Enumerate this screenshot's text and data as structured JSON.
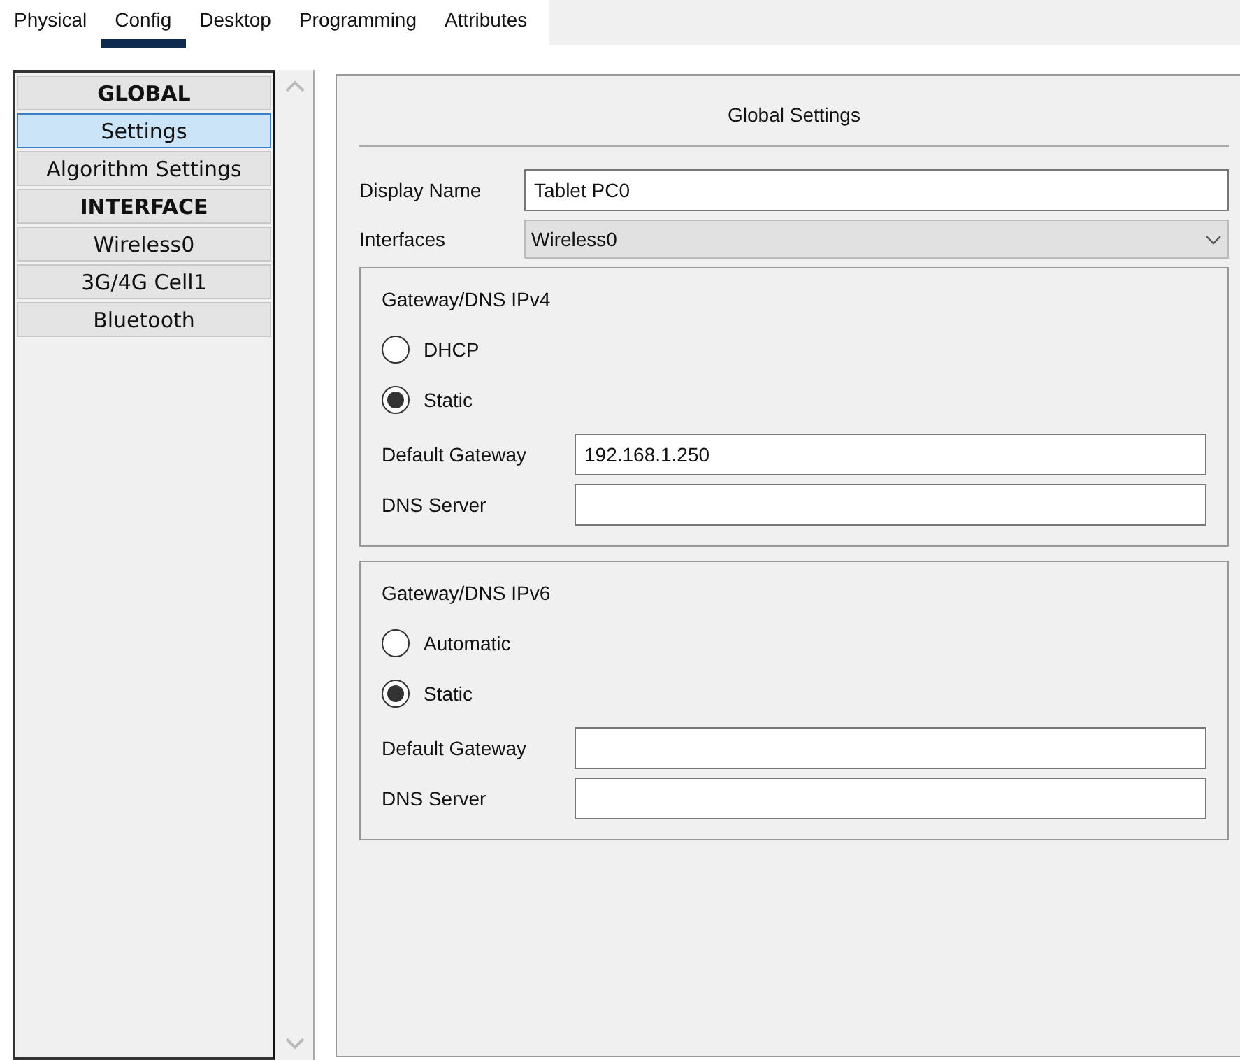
{
  "tabs": [
    {
      "label": "Physical",
      "selected": false
    },
    {
      "label": "Config",
      "selected": true
    },
    {
      "label": "Desktop",
      "selected": false
    },
    {
      "label": "Programming",
      "selected": false
    },
    {
      "label": "Attributes",
      "selected": false
    }
  ],
  "sidebar": {
    "items": [
      {
        "label": "GLOBAL",
        "kind": "header",
        "selected": false
      },
      {
        "label": "Settings",
        "kind": "item",
        "selected": true
      },
      {
        "label": "Algorithm Settings",
        "kind": "item",
        "selected": false
      },
      {
        "label": "INTERFACE",
        "kind": "header",
        "selected": false
      },
      {
        "label": "Wireless0",
        "kind": "item",
        "selected": false
      },
      {
        "label": "3G/4G Cell1",
        "kind": "item",
        "selected": false
      },
      {
        "label": "Bluetooth",
        "kind": "item",
        "selected": false
      }
    ]
  },
  "panel": {
    "title": "Global Settings",
    "display_name": {
      "label": "Display Name",
      "value": "Tablet PC0"
    },
    "interfaces": {
      "label": "Interfaces",
      "value": "Wireless0"
    },
    "groups": [
      {
        "title": "Gateway/DNS IPv4",
        "options": [
          {
            "label": "DHCP",
            "selected": false
          },
          {
            "label": "Static",
            "selected": true
          }
        ],
        "fields": [
          {
            "label": "Default Gateway",
            "value": "192.168.1.250"
          },
          {
            "label": "DNS Server"
          }
        ]
      },
      {
        "title": "Gateway/DNS IPv6",
        "options": [
          {
            "label": "Automatic",
            "selected": false
          },
          {
            "label": "Static",
            "selected": true
          }
        ],
        "fields": [
          {
            "label": "Default Gateway"
          },
          {
            "label": "DNS Server"
          }
        ]
      }
    ]
  }
}
